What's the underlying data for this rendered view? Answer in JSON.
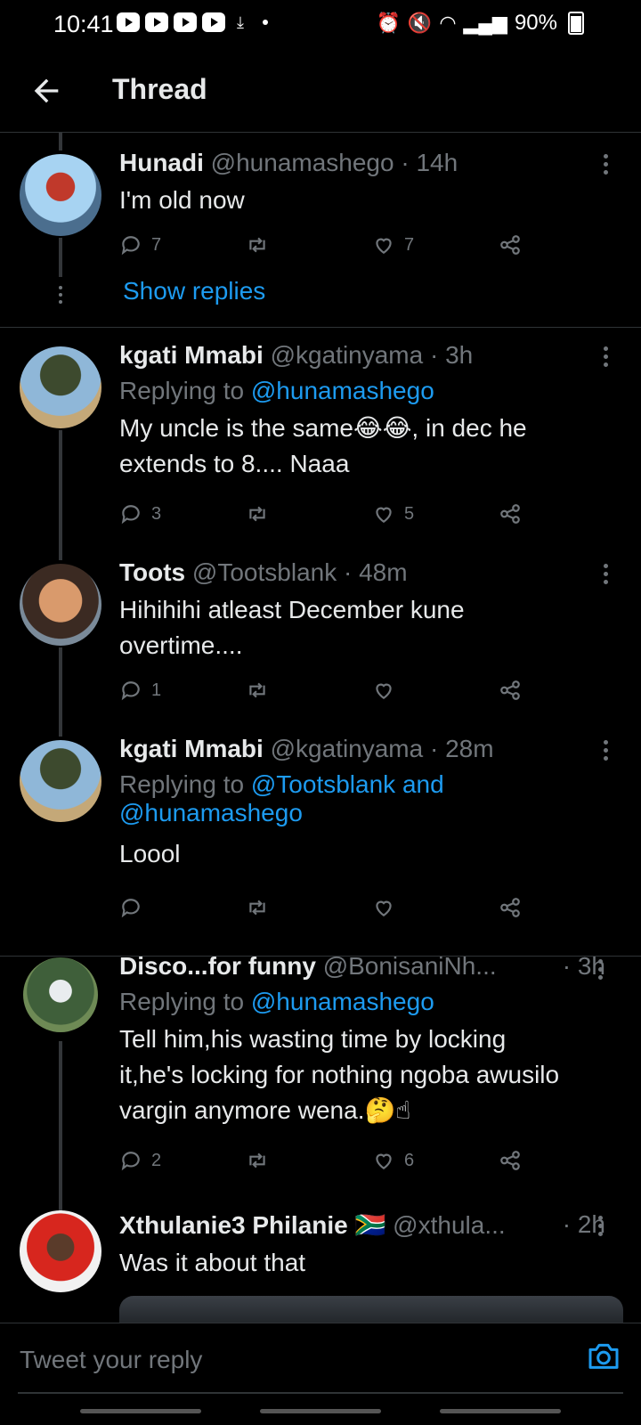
{
  "status_bar": {
    "time": "10:41",
    "battery": "90%"
  },
  "header": {
    "title": "Thread"
  },
  "tweets": [
    {
      "name": "Hunadi",
      "handle": "@hunamashego",
      "time": "· 14h",
      "text": "I'm old now",
      "replies": "7",
      "retweets": "",
      "likes": "7",
      "show_replies": "Show replies"
    },
    {
      "name": "kgati Mmabi",
      "handle": "@kgatinyama",
      "time": "· 3h",
      "replying_prefix": "Replying to",
      "replying_to": "@hunamashego",
      "text_line1": "My uncle is the same😂😂, in dec he",
      "text_line2": "extends to 8.... Naaa",
      "replies": "3",
      "likes": "5"
    },
    {
      "name": "Toots",
      "handle": "@Tootsblank",
      "time": "· 48m",
      "text_line1": "Hihihihi atleast December kune",
      "text_line2": "overtime....",
      "replies": "1",
      "likes": ""
    },
    {
      "name": "kgati Mmabi",
      "handle": "@kgatinyama",
      "time": "· 28m",
      "replying_prefix": "Replying to",
      "replying_to": "@Tootsblank and",
      "replying_to_2": "@hunamashego",
      "text": "Loool",
      "replies": "",
      "likes": ""
    },
    {
      "name": "Disco...for funny",
      "handle": "@BonisaniNh...",
      "time": "· 3h",
      "replying_prefix": "Replying to",
      "replying_to": "@hunamashego",
      "text_line1": "Tell him,his wasting time by locking",
      "text_line2": "it,he's locking for nothing ngoba awusilo",
      "text_line3": "vargin anymore wena.🤔☝",
      "replies": "2",
      "likes": "6"
    },
    {
      "name": "Xthulanie3 Philanie",
      "flag": "🇿🇦",
      "handle": "@xthula...",
      "time": "· 2h",
      "text": "Was it about that"
    }
  ],
  "reply_bar": {
    "placeholder": "Tweet your reply"
  },
  "colors": {
    "accent": "#1d9bf0",
    "muted": "#71767b",
    "background": "#000000",
    "divider": "#2f3336"
  },
  "icons": [
    "back-arrow-icon",
    "reply-icon",
    "retweet-icon",
    "like-icon",
    "share-icon",
    "more-icon",
    "camera-icon"
  ]
}
